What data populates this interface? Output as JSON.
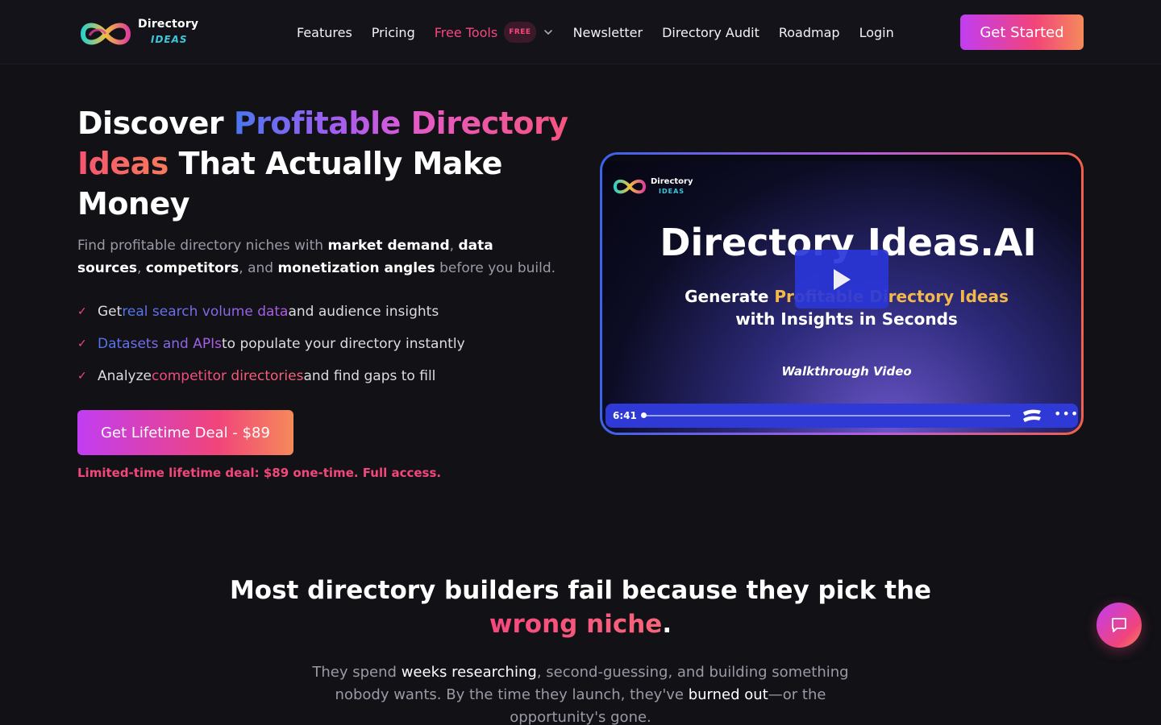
{
  "nav": {
    "logo": {
      "line1": "Directory",
      "line2": "IDEAS"
    },
    "links": {
      "features": "Features",
      "pricing": "Pricing",
      "free_tools": "Free Tools",
      "free_badge": "FREE",
      "newsletter": "Newsletter",
      "directory_audit": "Directory Audit",
      "roadmap": "Roadmap",
      "login": "Login"
    },
    "cta": "Get Started"
  },
  "hero": {
    "title": {
      "part1": "Discover ",
      "highlight1": "Profitable",
      "highlight2": "Directory",
      "highlight3": "Ideas",
      "part2": " That Actually Make Money"
    },
    "subtitle": {
      "t1": "Find profitable directory niches with ",
      "b1": "market demand",
      "t2": ", ",
      "b2": "data sources",
      "t3": ", ",
      "b3": "competitors",
      "t4": ", and ",
      "b4": "monetization angles",
      "t5": " before you build."
    },
    "checklist": [
      {
        "pre": "Get ",
        "hl": "real search volume data",
        "post": " and audience insights"
      },
      {
        "pre": "",
        "hl": "Datasets and APIs",
        "post": " to populate your directory instantly"
      },
      {
        "pre": "Analyze ",
        "hl": "competitor directories",
        "post": " and find gaps to fill"
      }
    ],
    "deal_button": "Get Lifetime Deal - $89",
    "deal_note": "Limited-time lifetime deal: $89 one-time. Full access."
  },
  "video": {
    "logo_line1": "Directory",
    "logo_line2": "IDEAS",
    "title": "Directory Ideas.AI",
    "sub1_pre": "Generate ",
    "sub1_hl": "Profitable Directory Ideas",
    "sub2": "with Insights in Seconds",
    "caption": "Walkthrough Video",
    "duration": "6:41",
    "progress": 0
  },
  "section": {
    "title_pre": "Most directory builders fail because they pick the",
    "title_hl": "wrong niche",
    "title_post": ".",
    "body": {
      "t1": "They spend ",
      "b1": "weeks researching",
      "t2": ", second-guessing, and building something nobody wants. By the time they launch, they've ",
      "b2": "burned out",
      "t3": "—or the opportunity's gone."
    }
  },
  "colors": {
    "accent_pink": "#f7477e",
    "accent_blue": "#4a76f0",
    "accent_purple": "#c13df2",
    "background": "#111116",
    "player_bar": "#2f3ad6"
  }
}
